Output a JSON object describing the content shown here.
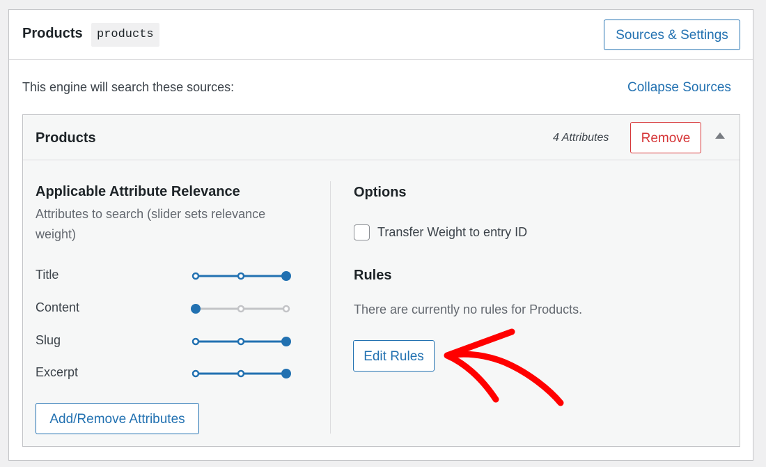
{
  "engine": {
    "title": "Products",
    "slug": "products",
    "sources_button": "Sources & Settings",
    "description": "This engine will search these sources:",
    "collapse_link": "Collapse Sources"
  },
  "source": {
    "title": "Products",
    "attribute_count": "4 Attributes",
    "remove_button": "Remove",
    "toggle_icon": "triangle-up-icon",
    "relevance": {
      "heading": "Applicable Attribute Relevance",
      "description": "Attributes to search (slider sets relevance weight)",
      "attributes": [
        {
          "label": "Title",
          "weight_level": 3,
          "weight_max": 3
        },
        {
          "label": "Content",
          "weight_level": 1,
          "weight_max": 3
        },
        {
          "label": "Slug",
          "weight_level": 3,
          "weight_max": 3
        },
        {
          "label": "Excerpt",
          "weight_level": 3,
          "weight_max": 3
        }
      ],
      "add_remove_button": "Add/Remove Attributes"
    },
    "options": {
      "heading": "Options",
      "transfer_weight_label": "Transfer Weight to entry ID",
      "transfer_weight_checked": false
    },
    "rules": {
      "heading": "Rules",
      "empty_text": "There are currently no rules for Products.",
      "edit_button": "Edit Rules"
    }
  },
  "annotation": {
    "icon": "red-arrow-icon",
    "color": "#ff0000"
  },
  "colors": {
    "accent": "#2271b1",
    "danger": "#d63638",
    "slider_inactive": "#c3c4c7"
  }
}
